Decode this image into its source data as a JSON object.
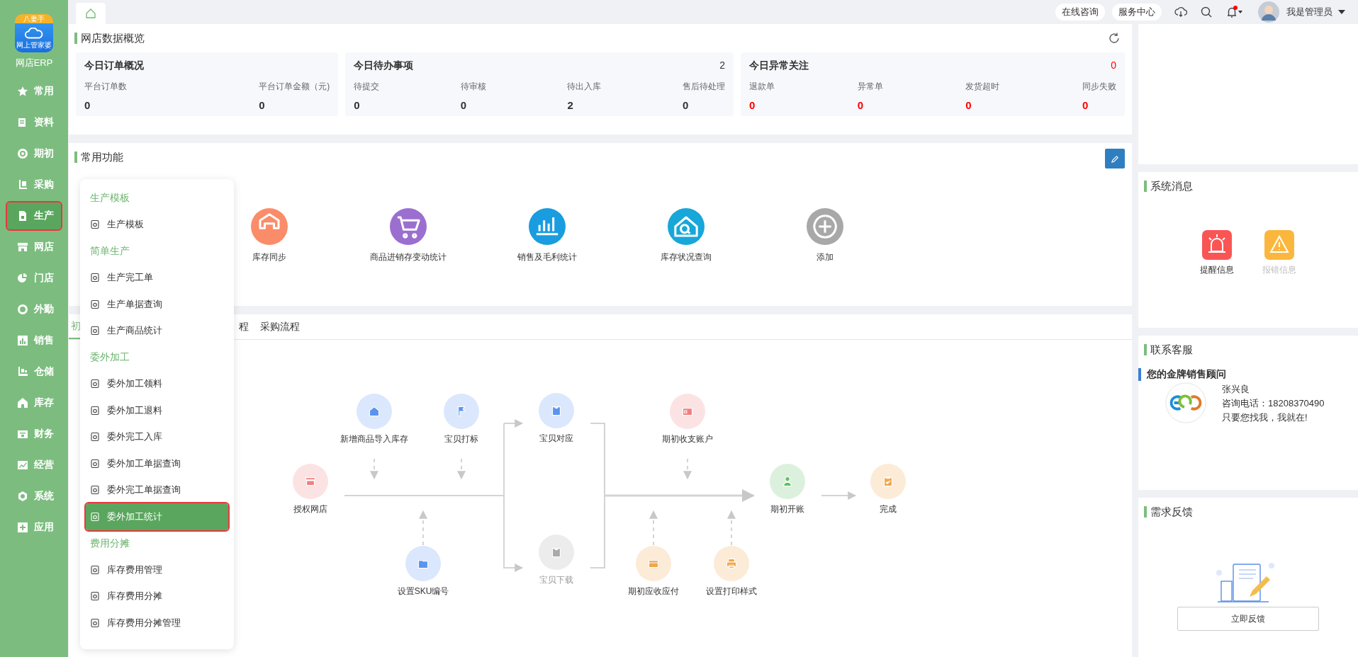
{
  "sidebar": {
    "logo_badge": "八妻手",
    "logo_text": "网上管家婆",
    "app_name": "网店ERP",
    "items": [
      {
        "label": "常用",
        "selected": false
      },
      {
        "label": "资料",
        "selected": false
      },
      {
        "label": "期初",
        "selected": false
      },
      {
        "label": "采购",
        "selected": false
      },
      {
        "label": "生产",
        "selected": true
      },
      {
        "label": "网店",
        "selected": false
      },
      {
        "label": "门店",
        "selected": false
      },
      {
        "label": "外勤",
        "selected": false
      },
      {
        "label": "销售",
        "selected": false
      },
      {
        "label": "仓储",
        "selected": false
      },
      {
        "label": "库存",
        "selected": false
      },
      {
        "label": "财务",
        "selected": false
      },
      {
        "label": "经营",
        "selected": false
      },
      {
        "label": "系统",
        "selected": false
      },
      {
        "label": "应用",
        "selected": false
      }
    ]
  },
  "topbar": {
    "buttons": [
      "在线咨询",
      "服务中心"
    ],
    "notification_unread": true,
    "user": "我是管理员"
  },
  "submenu": {
    "groups": [
      {
        "title": "生产模板",
        "items": [
          {
            "label": "生产模板",
            "selected": false
          }
        ]
      },
      {
        "title": "简单生产",
        "items": [
          {
            "label": "生产完工单",
            "selected": false
          },
          {
            "label": "生产单据查询",
            "selected": false
          },
          {
            "label": "生产商品统计",
            "selected": false
          }
        ]
      },
      {
        "title": "委外加工",
        "items": [
          {
            "label": "委外加工领料",
            "selected": false
          },
          {
            "label": "委外加工退料",
            "selected": false
          },
          {
            "label": "委外完工入库",
            "selected": false
          },
          {
            "label": "委外加工单据查询",
            "selected": false
          },
          {
            "label": "委外完工单据查询",
            "selected": false
          },
          {
            "label": "委外加工统计",
            "selected": true
          }
        ]
      },
      {
        "title": "费用分摊",
        "items": [
          {
            "label": "库存费用管理",
            "selected": false
          },
          {
            "label": "库存费用分摊",
            "selected": false
          },
          {
            "label": "库存费用分摊管理",
            "selected": false
          }
        ]
      }
    ]
  },
  "overview": {
    "title": "网店数据概览",
    "cards": [
      {
        "title": "今日订单概况",
        "alert": false,
        "metrics": [
          {
            "label": "平台订单数",
            "value": "0"
          },
          {
            "label": "平台订单金额（元)",
            "value": "0"
          }
        ]
      },
      {
        "title": "今日待办事项",
        "count": "2",
        "alert": false,
        "metrics": [
          {
            "label": "待提交",
            "value": "0"
          },
          {
            "label": "待审核",
            "value": "0"
          },
          {
            "label": "待出入库",
            "value": "2"
          },
          {
            "label": "售后待处理",
            "value": "0"
          }
        ]
      },
      {
        "title": "今日异常关注",
        "count": "0",
        "alert": true,
        "metrics": [
          {
            "label": "退款单",
            "value": "0"
          },
          {
            "label": "异常单",
            "value": "0"
          },
          {
            "label": "发货超时",
            "value": "0"
          },
          {
            "label": "同步失败",
            "value": "0"
          }
        ]
      }
    ]
  },
  "functions": {
    "title": "常用功能",
    "items": [
      {
        "label": "库存同步",
        "color": "#fb8c6a"
      },
      {
        "label": "商品进销存变动统计",
        "color": "#9b6fd0"
      },
      {
        "label": "销售及毛利统计",
        "color": "#1a9ce0"
      },
      {
        "label": "库存状况查询",
        "color": "#17a7d8"
      },
      {
        "label": "添加",
        "color": "#a8a8a8"
      }
    ]
  },
  "flow": {
    "tabs": [
      {
        "label": "初",
        "selected": true
      },
      {
        "label": "程",
        "selected": false
      },
      {
        "label": "采购流程",
        "selected": false
      }
    ],
    "nodes": [
      {
        "label": "授权网店",
        "color": "#f08080",
        "disabled": false
      },
      {
        "label": "新增商品导入库存",
        "color": "#5b93f0",
        "disabled": false
      },
      {
        "label": "宝贝打标",
        "color": "#5b93f0",
        "disabled": false
      },
      {
        "label": "宝贝对应",
        "color": "#5b93f0",
        "disabled": false
      },
      {
        "label": "宝贝下载",
        "color": "#a9a9a9",
        "disabled": true
      },
      {
        "label": "设置SKU编号",
        "color": "#5b93f0",
        "disabled": false
      },
      {
        "label": "期初收支账户",
        "color": "#f08080",
        "disabled": false
      },
      {
        "label": "期初应收应付",
        "color": "#f0a64a",
        "disabled": false
      },
      {
        "label": "设置打印样式",
        "color": "#f0a64a",
        "disabled": false
      },
      {
        "label": "期初开账",
        "color": "#5fc064",
        "disabled": false
      },
      {
        "label": "完成",
        "color": "#f0a64a",
        "disabled": false
      }
    ]
  },
  "messages": {
    "title": "系统消息",
    "items": [
      {
        "label": "提醒信息",
        "color": "#fa5555",
        "disabled": false
      },
      {
        "label": "报错信息",
        "color": "#fbb73d",
        "disabled": true
      }
    ]
  },
  "service": {
    "title": "联系客服",
    "subtitle": "您的金牌销售顾问",
    "name": "张兴良",
    "phone": "咨询电话：18208370490",
    "slogan": "只要您找我，我就在!"
  },
  "feedback": {
    "title": "需求反馈",
    "button": "立即反馈"
  }
}
